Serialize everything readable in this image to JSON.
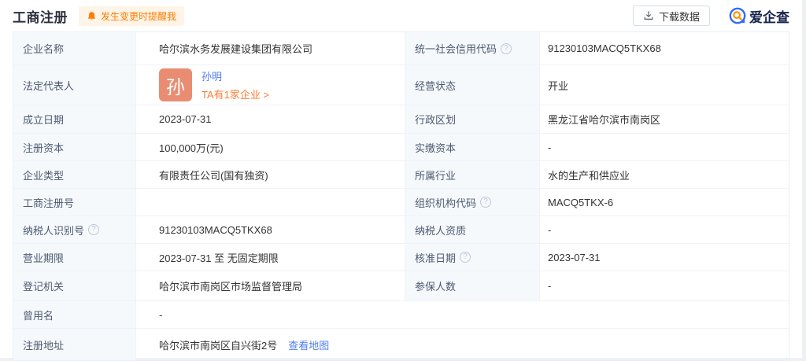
{
  "header": {
    "title": "工商注册",
    "notify_reminder": "发生变更时提醒我",
    "download_label": "下载数据",
    "brand": "爱企查"
  },
  "legal_rep": {
    "avatar_char": "孙",
    "name": "孙明",
    "companies_link": "TA有1家企业 >"
  },
  "registration": {
    "rows": [
      {
        "l_label": "企业名称",
        "l_value": "哈尔滨水务发展建设集团有限公司",
        "r_label": "统一社会信用代码",
        "r_value": "91230103MACQ5TKX68"
      },
      {
        "l_label": "法定代表人",
        "r_label": "经营状态",
        "r_value": "开业"
      },
      {
        "l_label": "成立日期",
        "l_value": "2023-07-31",
        "r_label": "行政区划",
        "r_value": "黑龙江省哈尔滨市南岗区"
      },
      {
        "l_label": "注册资本",
        "l_value": "100,000万(元)",
        "r_label": "实缴资本",
        "r_value": "-"
      },
      {
        "l_label": "企业类型",
        "l_value": "有限责任公司(国有独资)",
        "r_label": "所属行业",
        "r_value": "水的生产和供应业"
      },
      {
        "l_label": "工商注册号",
        "l_value": "",
        "r_label": "组织机构代码",
        "r_value": "MACQ5TKX-6"
      },
      {
        "l_label": "纳税人识别号",
        "l_value": "91230103MACQ5TKX68",
        "r_label": "纳税人资质",
        "r_value": "-"
      },
      {
        "l_label": "营业期限",
        "l_value": "2023-07-31 至 无固定期限",
        "r_label": "核准日期",
        "r_value": "2023-07-31"
      },
      {
        "l_label": "登记机关",
        "l_value": "哈尔滨市南岗区市场监督管理局",
        "r_label": "参保人数",
        "r_value": "-"
      },
      {
        "l_label": "曾用名",
        "l_value": "-"
      },
      {
        "l_label": "注册地址",
        "l_value": "哈尔滨市南岗区自兴街2号",
        "map_link": "查看地图"
      }
    ]
  },
  "colors": {
    "accent_orange": "#ff7d00",
    "link_blue": "#4f7df2",
    "link_orange": "#ff7c33",
    "avatar_bg": "#e98d72",
    "badge_bg": "#fff4e8",
    "label_bg": "#f6f9fc",
    "brand_blue": "#2f6bff",
    "brand_orange": "#ff9500"
  }
}
